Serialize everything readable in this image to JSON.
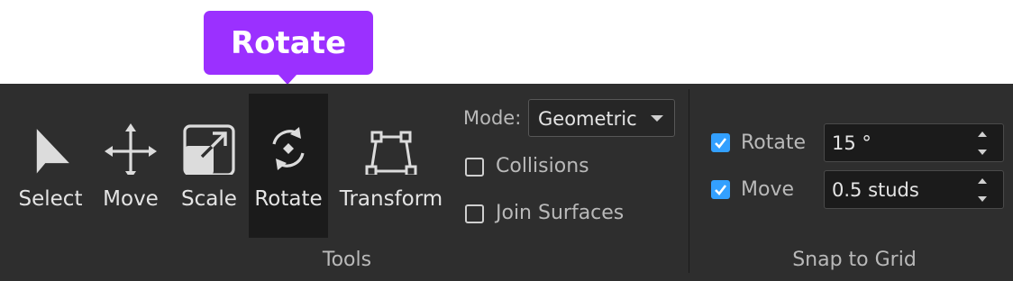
{
  "tooltip": {
    "text": "Rotate"
  },
  "tools": [
    {
      "label": "Select",
      "icon": "cursor-arrow-icon"
    },
    {
      "label": "Move",
      "icon": "move-arrows-icon"
    },
    {
      "label": "Scale",
      "icon": "scale-icon"
    },
    {
      "label": "Rotate",
      "icon": "rotate-icon",
      "active": true
    },
    {
      "label": "Transform",
      "icon": "transform-icon"
    }
  ],
  "mode": {
    "label": "Mode:",
    "value": "Geometric"
  },
  "options": {
    "collisions": {
      "label": "Collisions",
      "checked": false
    },
    "join_surfaces": {
      "label": "Join Surfaces",
      "checked": false
    }
  },
  "group_labels": {
    "tools": "Tools",
    "snap": "Snap to Grid"
  },
  "snap": {
    "rotate": {
      "label": "Rotate",
      "checked": true,
      "value": "15 °"
    },
    "move": {
      "label": "Move",
      "checked": true,
      "value": "0.5 studs"
    }
  },
  "colors": {
    "tooltip": "#9b30ff",
    "ribbon": "#2e2e2e",
    "active_tool": "#1b1b1b",
    "checkbox_on": "#33a0ff"
  }
}
